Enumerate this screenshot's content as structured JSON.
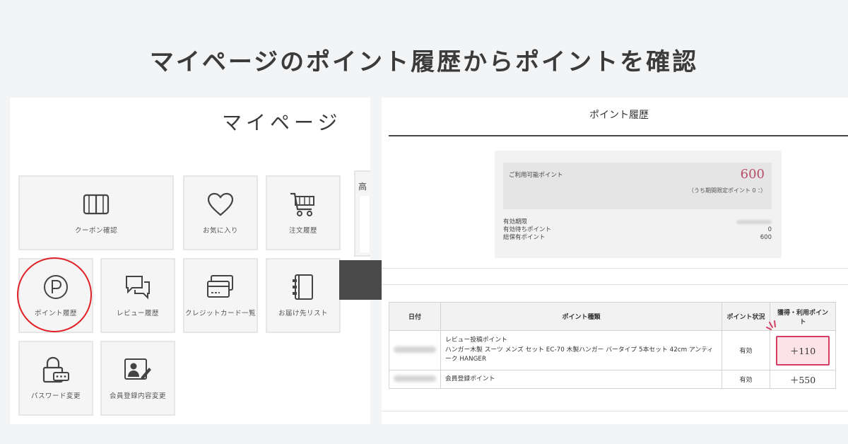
{
  "headline": "マイページのポイント履歴からポイントを確認",
  "mypage": {
    "title": "マイページ",
    "peek_label": "高",
    "tiles": [
      {
        "label": "クーポン確認",
        "icon": "coupon-book-icon"
      },
      {
        "label": "お気に入り",
        "icon": "heart-icon"
      },
      {
        "label": "注文履歴",
        "icon": "cart-icon"
      },
      {
        "label": "ポイント履歴",
        "icon": "point-p-icon"
      },
      {
        "label": "レビュー履歴",
        "icon": "chat-bubbles-icon"
      },
      {
        "label": "クレジットカード一覧",
        "icon": "credit-card-icon"
      },
      {
        "label": "お届け先リスト",
        "icon": "address-book-icon"
      },
      {
        "label": "パスワード変更",
        "icon": "lock-icon"
      },
      {
        "label": "会員登録内容変更",
        "icon": "profile-edit-icon"
      }
    ]
  },
  "points": {
    "title": "ポイント履歴",
    "available_label": "ご利用可能ポイント",
    "available_value": "600",
    "limited_note": "（うち期間限定ポイント 0 ：）",
    "expiry_label": "有効期限",
    "pending_label": "有効待ちポイント",
    "pending_value": "0",
    "total_label": "総保有ポイント",
    "total_value": "600",
    "table": {
      "headers": [
        "日付",
        "ポイント種類",
        "ポイント状況",
        "獲得・利用ポイント"
      ],
      "rows": [
        {
          "type_title": "レビュー投稿ポイント",
          "type_detail": "ハンガー木製 スーツ メンズ セット EC-70 木製ハンガー バータイプ 5本セット 42cm アンティーク HANGER",
          "status": "有効",
          "points": "＋110"
        },
        {
          "type_title": "会員登録ポイント",
          "type_detail": "",
          "status": "有効",
          "points": "＋550"
        }
      ]
    }
  },
  "colors": {
    "highlight_circle": "#e02127",
    "points_accent": "#b84d6a",
    "points_box_border": "#d23f62",
    "arrow": "#4a4a4a"
  }
}
